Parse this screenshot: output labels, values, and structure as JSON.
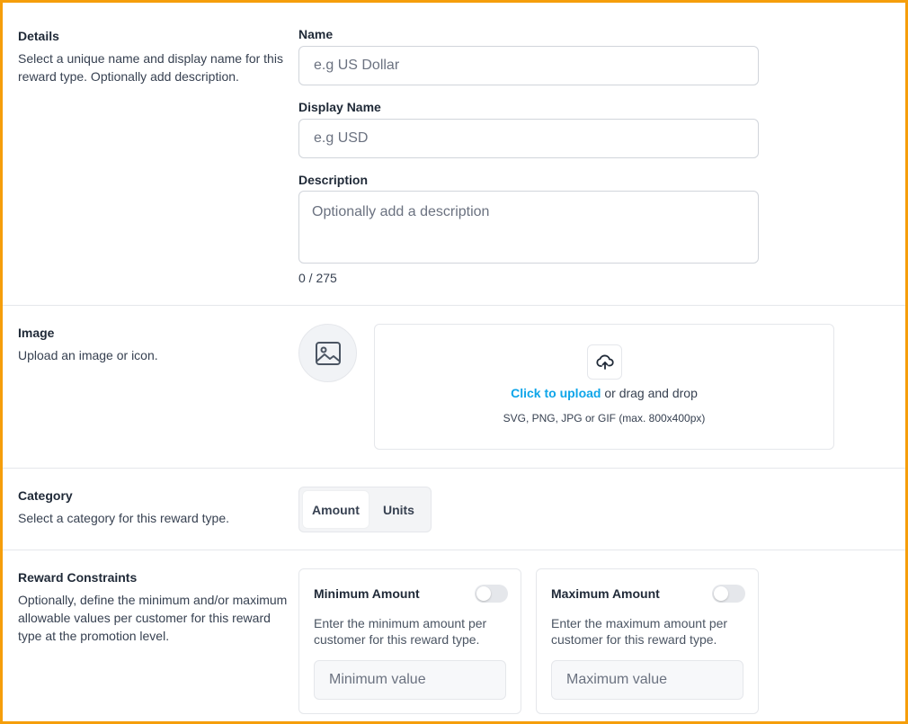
{
  "details": {
    "title": "Details",
    "description": "Select a unique name and display name for this reward type. Optionally add description.",
    "name_label": "Name",
    "name_placeholder": "e.g US Dollar",
    "display_name_label": "Display Name",
    "display_name_placeholder": "e.g USD",
    "description_label": "Description",
    "description_placeholder": "Optionally add a description",
    "counter": "0 / 275"
  },
  "image": {
    "title": "Image",
    "description": "Upload an image or icon.",
    "preview_icon": "image-icon",
    "upload_icon": "cloud-upload-icon",
    "upload_link": "Click to upload",
    "upload_rest": " or drag and drop",
    "upload_hint": "SVG, PNG, JPG or GIF (max. 800x400px)"
  },
  "category": {
    "title": "Category",
    "description": "Select a category for this reward type.",
    "options": [
      "Amount",
      "Units"
    ],
    "selected": "Amount"
  },
  "constraints": {
    "title": "Reward Constraints",
    "description": "Optionally, define the minimum and/or maximum allowable values per customer for this reward type at the promotion level.",
    "min": {
      "title": "Minimum Amount",
      "description": "Enter the minimum amount per customer for this reward type.",
      "placeholder": "Minimum value",
      "enabled": false
    },
    "max": {
      "title": "Maximum Amount",
      "description": "Enter the maximum amount per customer for this reward type.",
      "placeholder": "Maximum value",
      "enabled": false
    }
  },
  "colors": {
    "accent_link": "#0ea5e9",
    "frame_border": "#f59e0b",
    "divider": "#e5e7eb"
  }
}
